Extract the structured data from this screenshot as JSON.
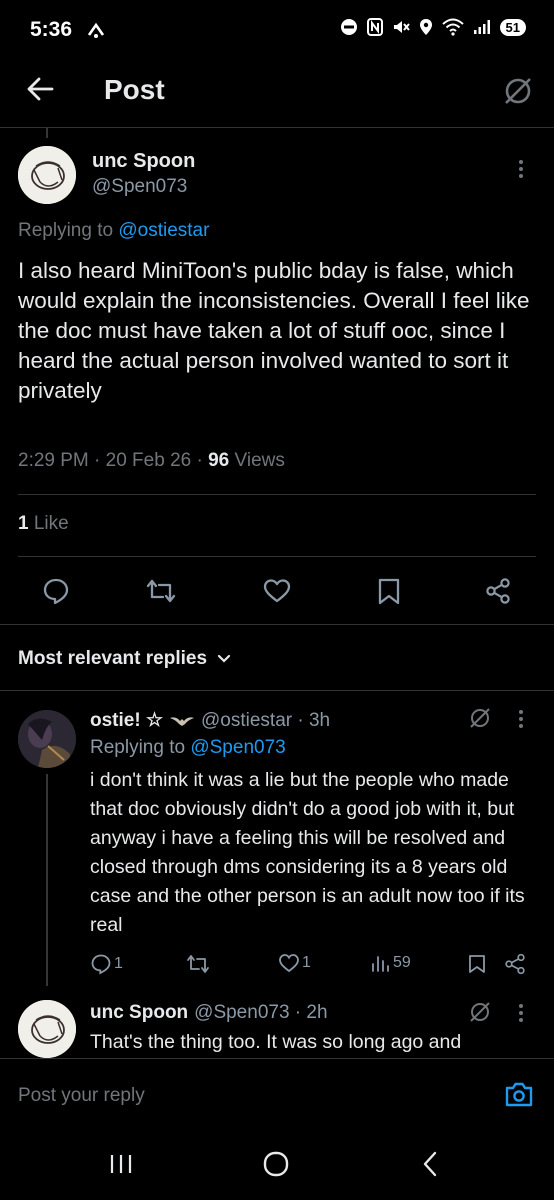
{
  "status": {
    "time": "5:36",
    "battery": "51"
  },
  "header": {
    "title": "Post"
  },
  "main_post": {
    "display_name": "unc Spoon",
    "handle": "@Spen073",
    "replying_prefix": "Replying to",
    "replying_handle": "@ostiestar",
    "text": "I also heard MiniToon's public bday is false, which would explain the inconsistencies. Overall I feel like the doc must have taken a lot of stuff ooc, since I heard the actual person involved wanted to sort it privately",
    "timestamp": "2:29 PM · 20 Feb 26 ·",
    "views_count": "96",
    "views_label": "Views",
    "likes_count": "1",
    "likes_label": "Like"
  },
  "replies_section": {
    "sort_label": "Most relevant replies"
  },
  "replies": [
    {
      "display_name": "ostie! ☆",
      "handle_time": "@ostiestar · 3h",
      "replying_prefix": "Replying to",
      "replying_handle": "@Spen073",
      "text": "i don't think it was a lie but the people who made that doc obviously didn't do a good job with it, but anyway i have a feeling this will be resolved and closed through dms considering its a 8 years old case and the other person is an adult now too if its real",
      "reply_count": "1",
      "like_count": "1",
      "view_count": "59"
    },
    {
      "display_name": "unc Spoon",
      "handle_time": "@Spen073 · 2h",
      "text": "That's the thing too. It was so long ago and"
    }
  ],
  "composer": {
    "placeholder": "Post your reply"
  },
  "colors": {
    "accent": "#1d9bf0",
    "background": "#000000",
    "muted": "#71767b"
  }
}
